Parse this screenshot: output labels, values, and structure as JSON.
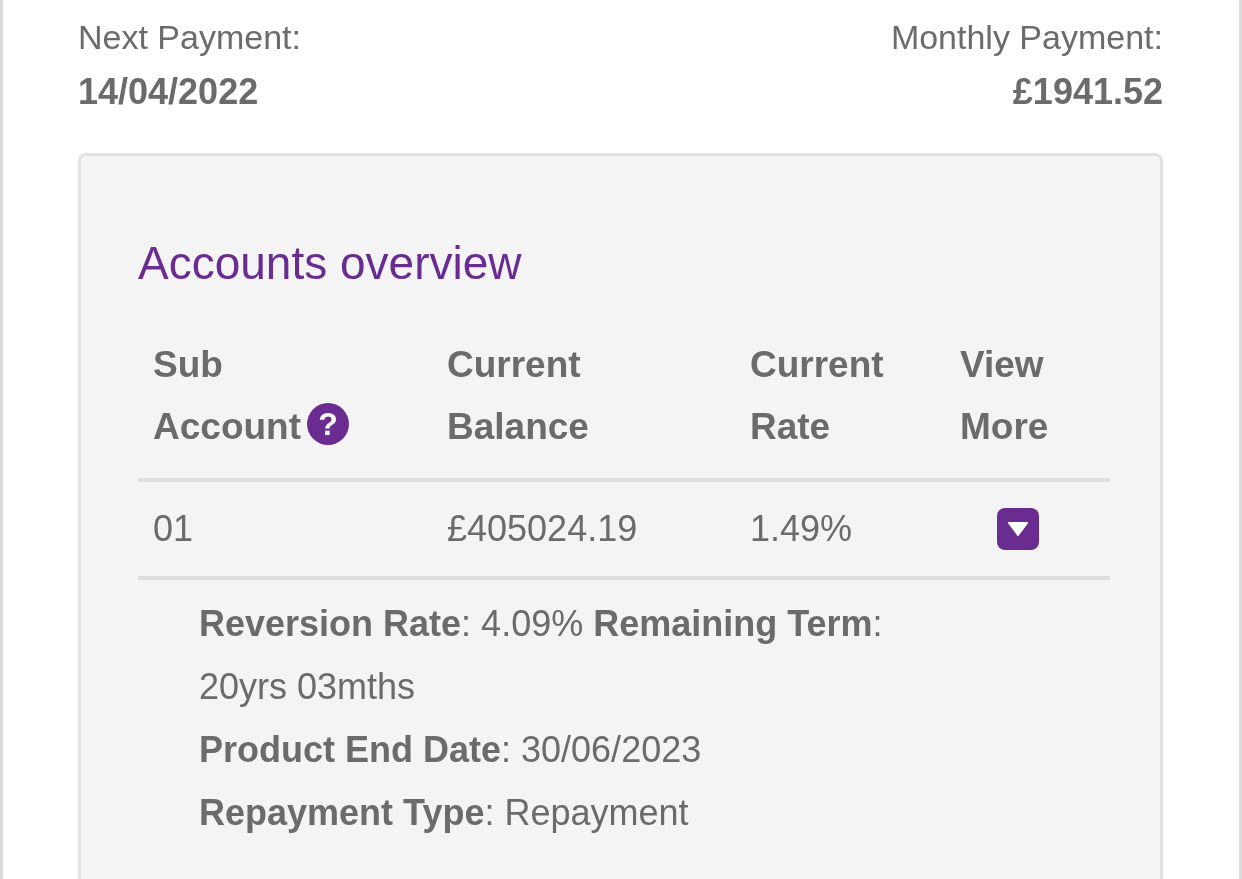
{
  "summary": [
    {
      "label": "Next Payment:",
      "value": "14/04/2022"
    },
    {
      "label": "Monthly Payment:",
      "value": "£1941.52"
    }
  ],
  "accounts_overview": {
    "title": "Accounts overview",
    "columns": [
      {
        "label": "Sub Account",
        "help_icon": "?"
      },
      {
        "label": "Current Balance"
      },
      {
        "label": "Current Rate"
      },
      {
        "label": "View More"
      }
    ],
    "rows": [
      {
        "sub_account": "01",
        "current_balance": "£405024.19",
        "current_rate": "1.49%",
        "expanded": true,
        "details": [
          "**Reversion Rate**: 4.09% **Remaining Term**: 20yrs 03mths",
          "**Product End Date**: 30/06/2023",
          "**Repayment Type**: Repayment"
        ]
      }
    ]
  }
}
